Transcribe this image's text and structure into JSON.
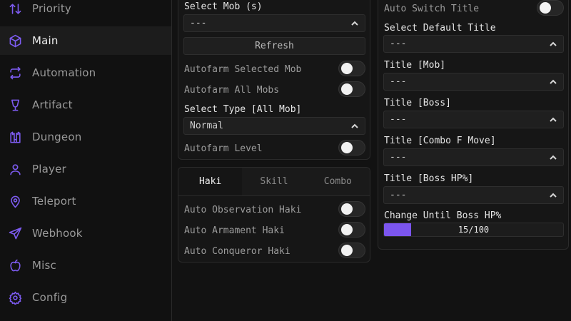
{
  "sidebar": {
    "items": [
      {
        "label": "Priority",
        "icon": "sort-arrows-icon",
        "active": false
      },
      {
        "label": "Main",
        "icon": "cube-icon",
        "active": true
      },
      {
        "label": "Automation",
        "icon": "repeat-icon",
        "active": false
      },
      {
        "label": "Artifact",
        "icon": "goblet-icon",
        "active": false
      },
      {
        "label": "Dungeon",
        "icon": "castle-icon",
        "active": false
      },
      {
        "label": "Player",
        "icon": "user-icon",
        "active": false
      },
      {
        "label": "Teleport",
        "icon": "map-pin-icon",
        "active": false
      },
      {
        "label": "Webhook",
        "icon": "send-icon",
        "active": false
      },
      {
        "label": "Misc",
        "icon": "apple-icon",
        "active": false
      },
      {
        "label": "Config",
        "icon": "settings-cog-icon",
        "active": false
      }
    ]
  },
  "farm": {
    "select_mob_label": "Select Mob (s)",
    "select_mob_value": "---",
    "refresh_label": "Refresh",
    "autofarm_selected_label": "Autofarm Selected Mob",
    "autofarm_all_label": "Autofarm All Mobs",
    "select_type_label": "Select Type [All Mob]",
    "select_type_value": "Normal",
    "autofarm_level_label": "Autofarm Level"
  },
  "haki": {
    "tabs": [
      "Haki",
      "Skill",
      "Combo"
    ],
    "active_tab": "Haki",
    "observation_label": "Auto Observation Haki",
    "armament_label": "Auto Armament Haki",
    "conqueror_label": "Auto Conqueror Haki"
  },
  "title": {
    "auto_switch_label": "Auto Switch Title",
    "default_label": "Select Default Title",
    "default_value": "---",
    "mob_label": "Title [Mob]",
    "mob_value": "---",
    "boss_label": "Title [Boss]",
    "boss_value": "---",
    "combo_label": "Title [Combo F Move]",
    "combo_value": "---",
    "boss_hp_label": "Title [Boss HP%]",
    "boss_hp_value": "---",
    "change_until_label": "Change Until Boss HP%",
    "change_until_value": 15,
    "change_until_max": 100,
    "change_until_text": "15/100"
  },
  "colors": {
    "accent": "#7b55ee",
    "background": "#121212",
    "panel": "#161616"
  }
}
